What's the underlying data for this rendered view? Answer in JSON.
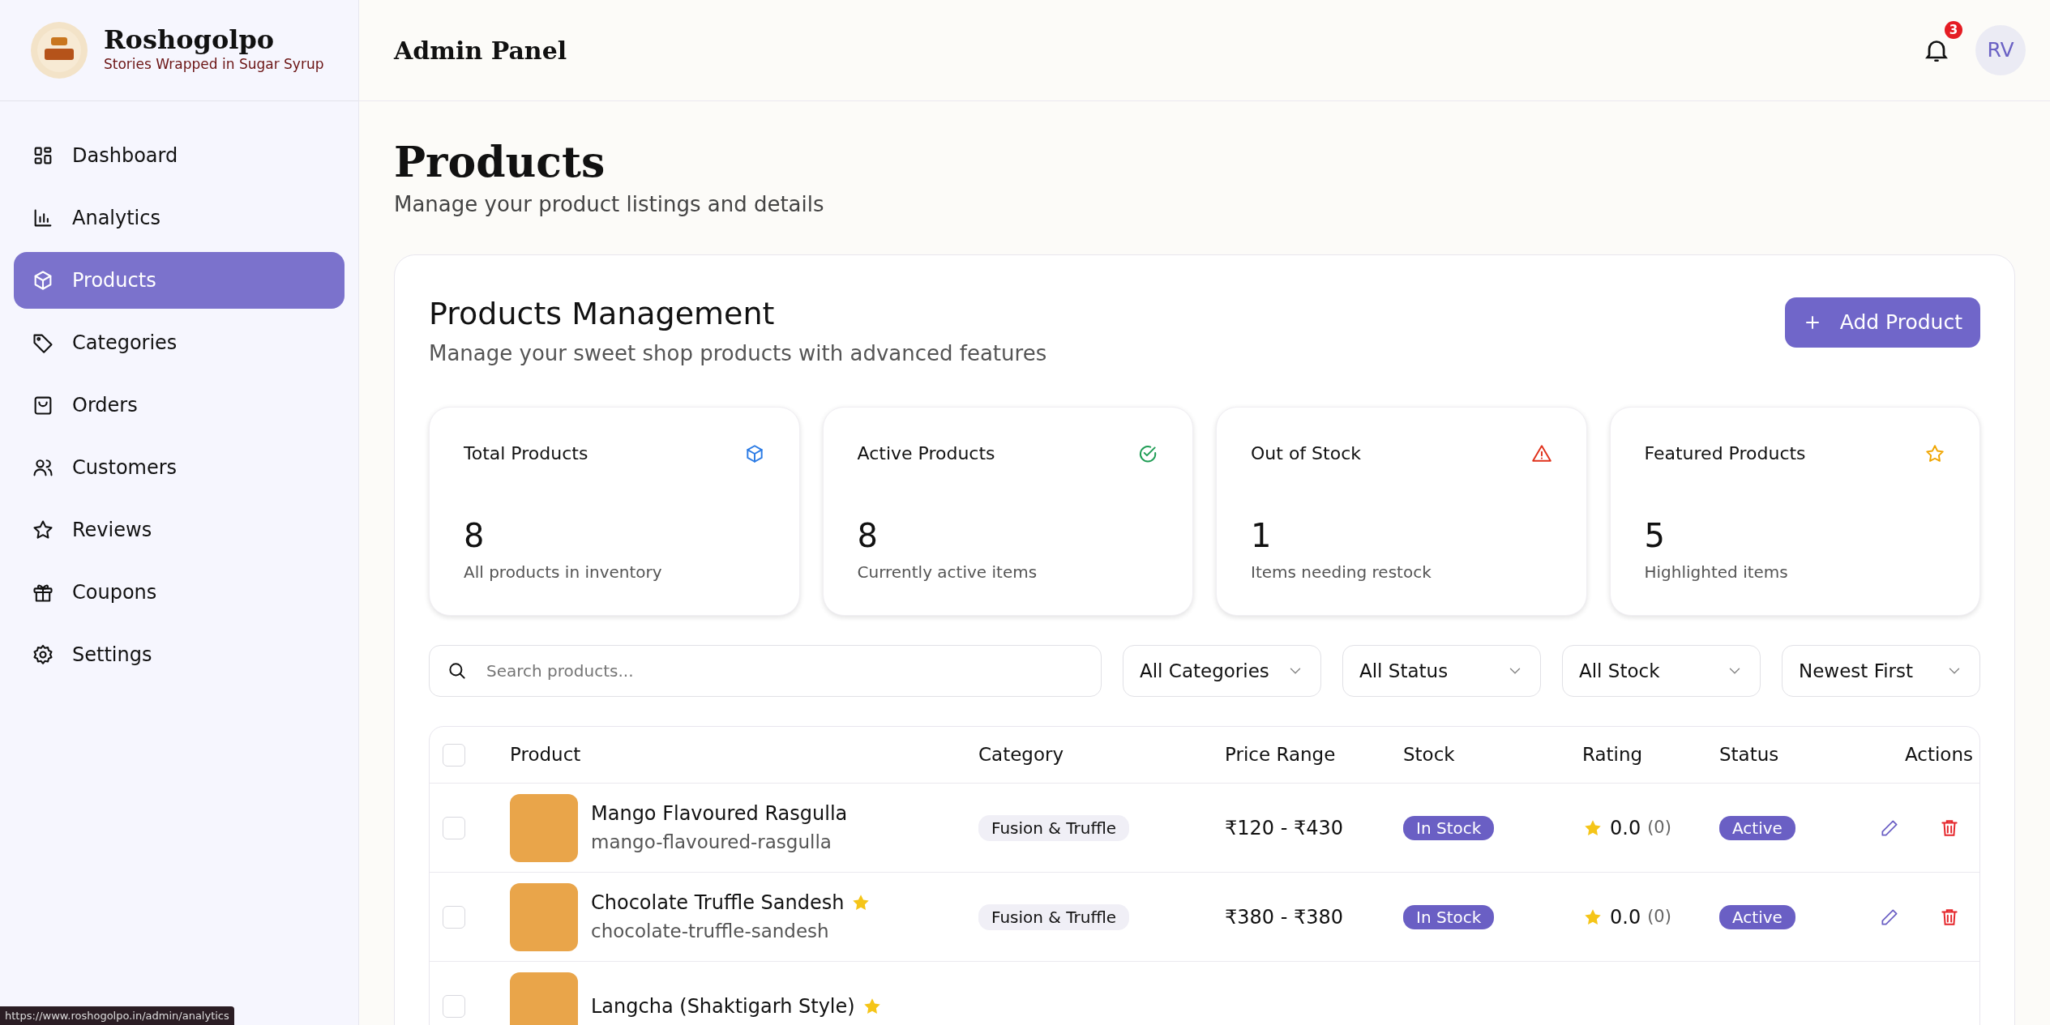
{
  "brand": {
    "name": "Roshogolpo",
    "tagline": "Stories Wrapped in Sugar Syrup"
  },
  "sidebar": {
    "items": [
      {
        "label": "Dashboard",
        "selected": false
      },
      {
        "label": "Analytics",
        "selected": false
      },
      {
        "label": "Products",
        "selected": true
      },
      {
        "label": "Categories",
        "selected": false
      },
      {
        "label": "Orders",
        "selected": false
      },
      {
        "label": "Customers",
        "selected": false
      },
      {
        "label": "Reviews",
        "selected": false
      },
      {
        "label": "Coupons",
        "selected": false
      },
      {
        "label": "Settings",
        "selected": false
      }
    ]
  },
  "header": {
    "title": "Admin Panel",
    "notification_count": "3",
    "avatar": "RV"
  },
  "page": {
    "title": "Products",
    "subtitle": "Manage your product listings and details"
  },
  "management": {
    "title": "Products Management",
    "subtitle": "Manage your sweet shop products with advanced features",
    "add_button": "Add Product"
  },
  "stats": [
    {
      "label": "Total Products",
      "value": "8",
      "note": "All products in inventory"
    },
    {
      "label": "Active Products",
      "value": "8",
      "note": "Currently active items"
    },
    {
      "label": "Out of Stock",
      "value": "1",
      "note": "Items needing restock"
    },
    {
      "label": "Featured Products",
      "value": "5",
      "note": "Highlighted items"
    }
  ],
  "filters": {
    "search": {
      "placeholder": "Search products..."
    },
    "selects": [
      "All Categories",
      "All Status",
      "All Stock",
      "Newest First"
    ]
  },
  "table": {
    "columns": [
      "Product",
      "Category",
      "Price Range",
      "Stock",
      "Rating",
      "Status",
      "Actions"
    ],
    "select_all_checked": false,
    "rows": [
      {
        "name": "Mango Flavoured Rasgulla",
        "slug": "mango-flavoured-rasgulla",
        "featured": false,
        "checked": false,
        "category": "Fusion & Truffle",
        "price": "₹120 - ₹430",
        "stock": "In Stock",
        "rating": "0.0",
        "reviews": "(0)",
        "status": "Active"
      },
      {
        "name": "Chocolate Truffle Sandesh",
        "slug": "chocolate-truffle-sandesh",
        "featured": true,
        "checked": false,
        "category": "Fusion & Truffle",
        "price": "₹380 - ₹380",
        "stock": "In Stock",
        "rating": "0.0",
        "reviews": "(0)",
        "status": "Active"
      },
      {
        "name": "Langcha (Shaktigarh Style)",
        "featured": true,
        "checked": false
      }
    ]
  },
  "status_bar": {
    "url": "https://www.roshogolpo.in/admin/analytics"
  }
}
